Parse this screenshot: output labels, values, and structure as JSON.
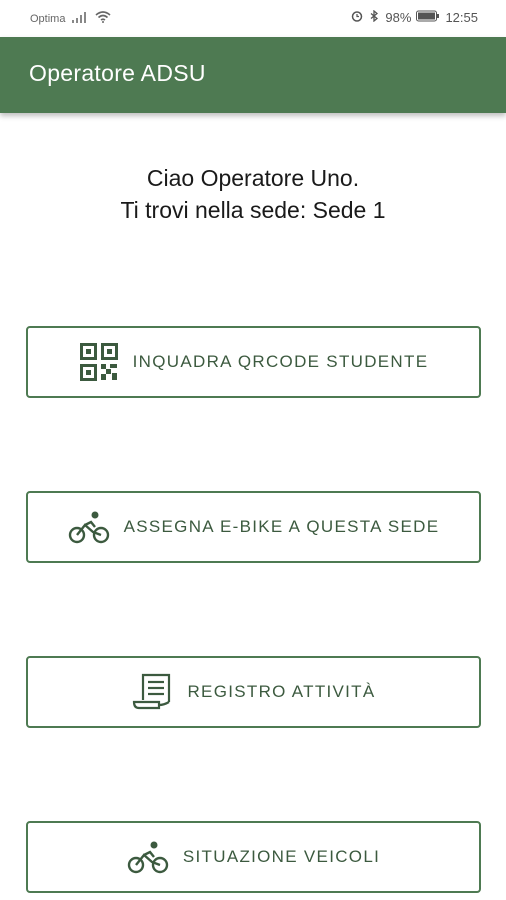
{
  "status_bar": {
    "carrier": "Optima",
    "battery": "98%",
    "time": "12:55",
    "icons": [
      "signal-icon",
      "wifi-icon",
      "alarm-icon",
      "bluetooth-icon",
      "battery-icon"
    ]
  },
  "app_bar": {
    "title": "Operatore ADSU",
    "color": "#4e7a52"
  },
  "greeting": {
    "line1": "Ciao Operatore Uno.",
    "line2": "Ti trovi nella sede: Sede 1"
  },
  "actions": [
    {
      "label": "INQUADRA QRCODE STUDENTE",
      "icon": "qrcode-icon"
    },
    {
      "label": "ASSEGNA E-BIKE A QUESTA SEDE",
      "icon": "bike-icon"
    },
    {
      "label": "REGISTRO ATTIVITÀ",
      "icon": "receipt-icon"
    },
    {
      "label": "SITUAZIONE VEICOLI",
      "icon": "bike-icon"
    }
  ],
  "accent_color": "#4e7a52"
}
